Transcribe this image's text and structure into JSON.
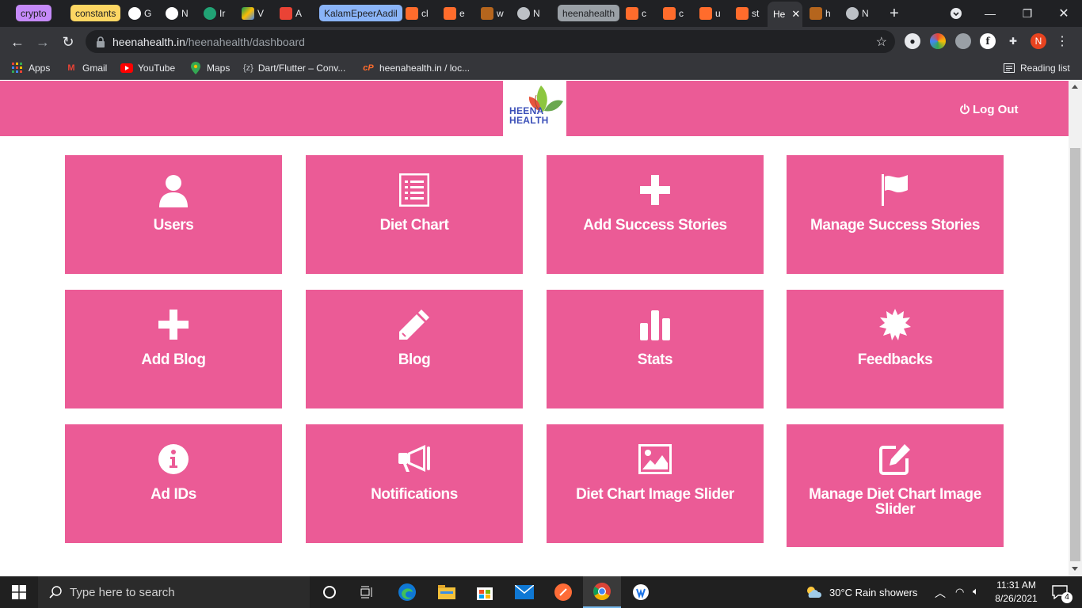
{
  "browser": {
    "tab_groups": [
      {
        "label": "crypto",
        "color": "#c58af9"
      },
      {
        "label": "constants",
        "color": "#fdd663"
      },
      {
        "label": "KalamEpeerAadil",
        "color": "#8ab4f8"
      },
      {
        "label": "heenahealth",
        "color": "#9aa0a6"
      }
    ],
    "tabs": [
      {
        "text": "G",
        "icon": "github-icon"
      },
      {
        "text": "N",
        "icon": "github-icon"
      },
      {
        "text": "Ir",
        "icon": "qt-icon"
      },
      {
        "text": "V",
        "icon": "drive-icon"
      },
      {
        "text": "A",
        "icon": "gmail-icon"
      },
      {
        "text": "cl",
        "icon": "cpanel-icon"
      },
      {
        "text": "e",
        "icon": "cpanel-icon"
      },
      {
        "text": "w",
        "icon": "ship-icon"
      },
      {
        "text": "N",
        "icon": "chrome-icon"
      },
      {
        "text": "c",
        "icon": "cpanel-icon"
      },
      {
        "text": "c",
        "icon": "cpanel-icon"
      },
      {
        "text": "u",
        "icon": "cpanel-icon"
      },
      {
        "text": "st",
        "icon": "cpanel-icon"
      },
      {
        "text": "h",
        "icon": "ship-icon"
      },
      {
        "text": "N",
        "icon": "chrome-icon"
      }
    ],
    "active_tab": "He",
    "url_domain": "heenahealth.in",
    "url_path": "/heenahealth/dashboard",
    "profile_initial": "N",
    "bookmarks": [
      {
        "label": "Apps",
        "icon": "apps-grid-icon"
      },
      {
        "label": "Gmail",
        "icon": "gmail-icon"
      },
      {
        "label": "YouTube",
        "icon": "youtube-icon"
      },
      {
        "label": "Maps",
        "icon": "maps-pin-icon"
      },
      {
        "label": "Dart/Flutter – Conv...",
        "icon": "curly-braces-icon",
        "icon_text": "{z}"
      },
      {
        "label": "heenahealth.in / loc...",
        "icon": "cpanel-icon"
      }
    ],
    "reading_list": "Reading list"
  },
  "page": {
    "brand_color": "#eb5b96",
    "logo_line1": "HEENA",
    "logo_line2": "HEALTH",
    "logout_label": "Log Out",
    "cards": [
      {
        "label": "Users",
        "icon": "user-icon"
      },
      {
        "label": "Diet Chart",
        "icon": "list-document-icon"
      },
      {
        "label": "Add Success Stories",
        "icon": "plus-icon"
      },
      {
        "label": "Manage Success Stories",
        "icon": "flag-icon"
      },
      {
        "label": "Add Blog",
        "icon": "plus-icon"
      },
      {
        "label": "Blog",
        "icon": "pencil-icon"
      },
      {
        "label": "Stats",
        "icon": "bar-chart-icon"
      },
      {
        "label": "Feedbacks",
        "icon": "badge-icon"
      },
      {
        "label": "Ad IDs",
        "icon": "info-icon"
      },
      {
        "label": "Notifications",
        "icon": "megaphone-icon"
      },
      {
        "label": "Diet Chart Image Slider",
        "icon": "image-icon"
      },
      {
        "label": "Manage Diet Chart Image Slider",
        "icon": "edit-icon"
      }
    ]
  },
  "taskbar": {
    "search_placeholder": "Type here to search",
    "weather": "30°C  Rain showers",
    "time": "11:31 AM",
    "date": "8/26/2021",
    "notification_count": "4"
  }
}
